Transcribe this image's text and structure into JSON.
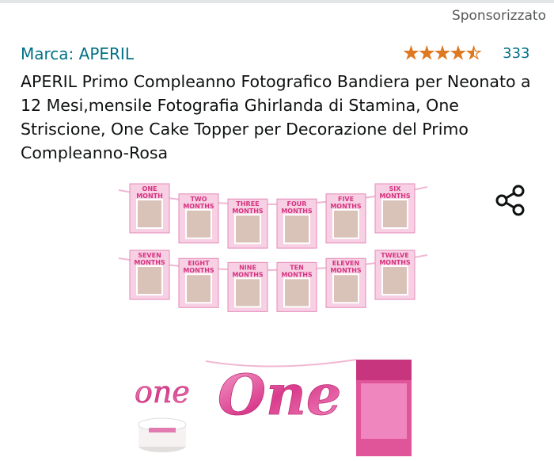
{
  "header": {
    "sponsored_label": "Sponsorizzato"
  },
  "product": {
    "brand": "Marca: APERIL",
    "rating": 4.5,
    "rating_count": "333",
    "title": "APERIL Primo Compleanno Fotografico Bandiera per Neonato a 12 Mesi,mensile Fotografia Ghirlanda di Stamina, One Striscione, One Cake Topper per Decorazione del Primo Compleanno-Rosa",
    "image_labels": {
      "row1": [
        "ONE MONTH",
        "TWO MONTHS",
        "THREE MONTHS",
        "FOUR MONTHS",
        "FIVE MONTHS",
        "SIX MONTHS"
      ],
      "row2": [
        "SEVEN MONTHS",
        "EIGHT MONTHS",
        "NINE MONTHS",
        "TEN MONTHS",
        "ELEVEN MONTHS",
        "TWELVE MONTHS"
      ],
      "one_small": "one",
      "one_large": "One"
    }
  },
  "icons": {
    "share": "share-icon",
    "stars": "star-rating-icon"
  },
  "colors": {
    "link": "#007185",
    "star": "#de7921",
    "text": "#0f1111",
    "muted": "#565959",
    "pink": "#e0559a"
  }
}
